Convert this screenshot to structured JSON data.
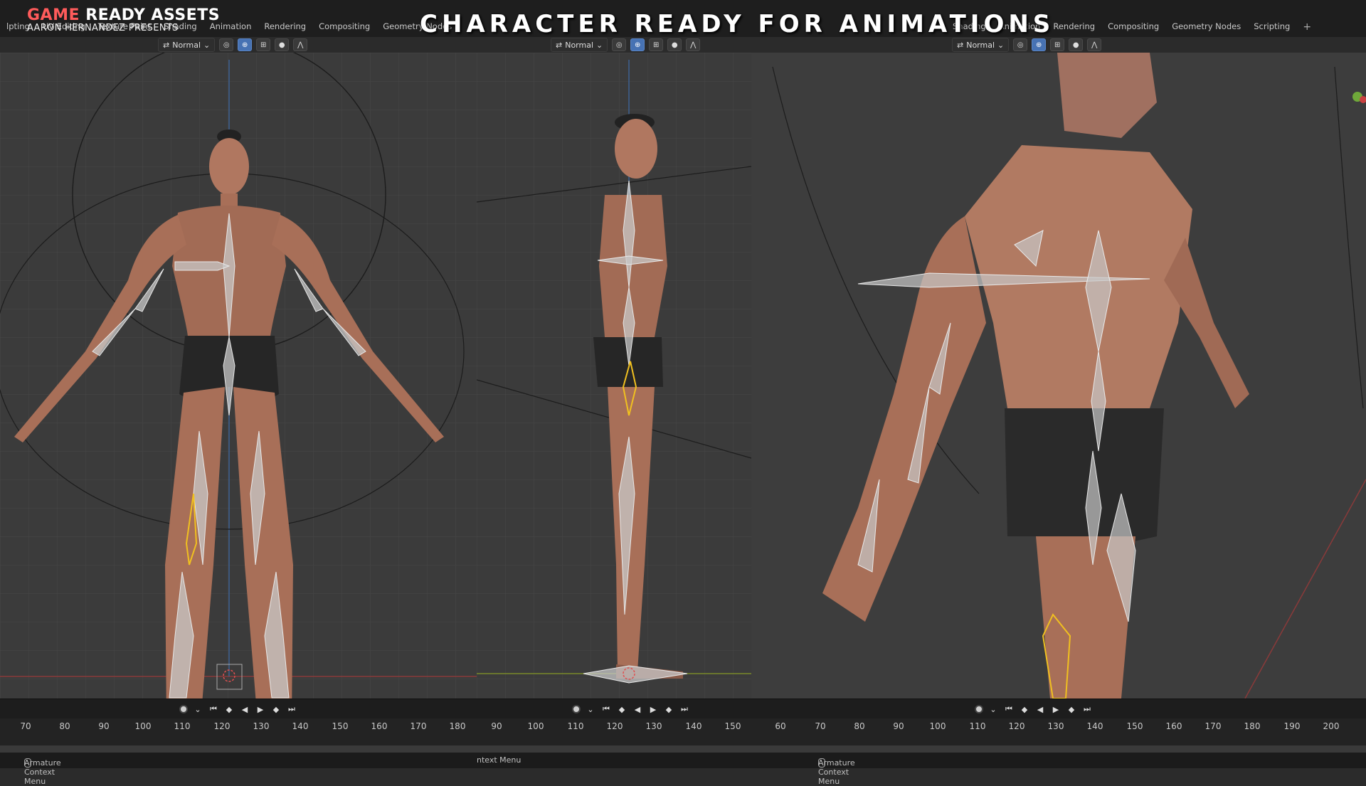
{
  "brand": {
    "word_game": "GAME",
    "rest": "READY ASSETS",
    "subtitle": "AARON HERNANDEZ PRESENTS"
  },
  "headline": "CHARACTER READY FOR ANIMATIONS",
  "menus": {
    "left": [
      "lpting",
      "UV Editing",
      "Texture Paint",
      "Shading",
      "Animation",
      "Rendering",
      "Compositing",
      "Geometry Nodes"
    ],
    "right": [
      "Shading",
      "Animation",
      "Rendering",
      "Compositing",
      "Geometry Nodes",
      "Scripting"
    ],
    "add_label": "+"
  },
  "toolbar": {
    "mode": "Normal"
  },
  "ruler": {
    "left": [
      "70",
      "80",
      "90",
      "100",
      "110",
      "120",
      "130",
      "140",
      "150",
      "160",
      "170",
      "180"
    ],
    "middle": [
      "90",
      "100",
      "110",
      "120",
      "130",
      "140",
      "150"
    ],
    "right": [
      "60",
      "70",
      "80",
      "90",
      "100",
      "110",
      "120",
      "130",
      "140",
      "150",
      "160",
      "170",
      "180",
      "190",
      "200"
    ]
  },
  "status": {
    "left": "Armature Context Menu",
    "middle": "ntext Menu",
    "right": "Armature Context Menu"
  },
  "colors": {
    "bg": "#2b2b2b",
    "header": "#1e1e1e",
    "accent_red": "#ff5b5b",
    "selected_bone": "#f0c020",
    "active_button": "#4772b3"
  },
  "icons": [
    "mouse-icon",
    "record-icon",
    "jump-start-icon",
    "prev-keyframe-icon",
    "play-reverse-icon",
    "play-icon",
    "next-keyframe-icon",
    "jump-end-icon"
  ]
}
